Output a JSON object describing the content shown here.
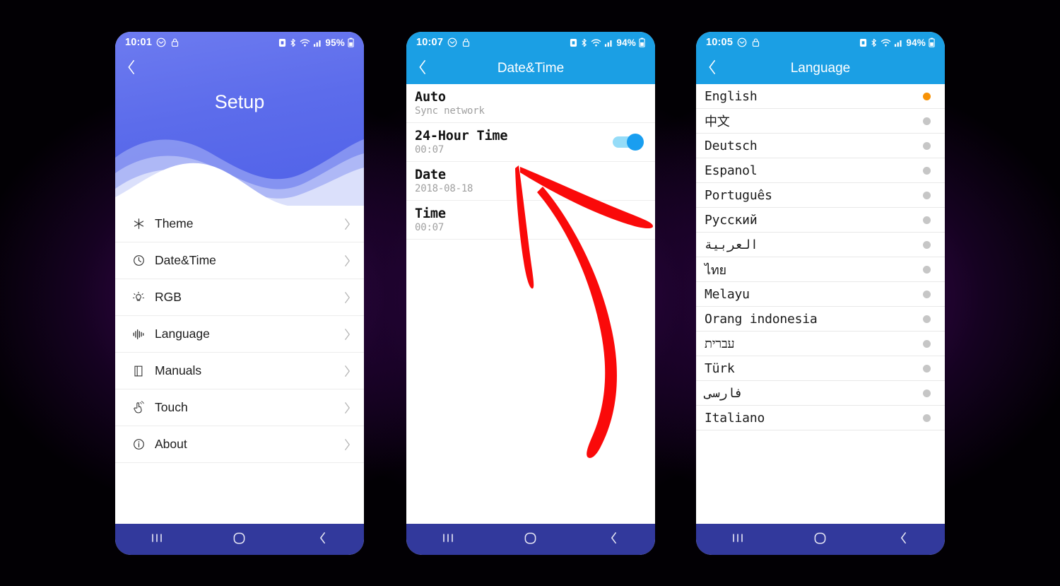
{
  "phones": [
    {
      "id": "setup",
      "statusbar": {
        "time": "10:01",
        "battery_pct": "95%",
        "icons_left": [
          "message-icon",
          "lock-icon"
        ],
        "icons_right": [
          "nfc-icon",
          "bluetooth-icon",
          "wifi-icon",
          "signal-icon",
          "battery-icon"
        ]
      },
      "appbar": {
        "title": "Setup",
        "back_icon": "chevron-left-icon"
      },
      "menu": [
        {
          "label": "Theme",
          "icon": "asterisk-icon",
          "chevron": "chevron-right-icon"
        },
        {
          "label": "Date&Time",
          "icon": "clock-icon",
          "chevron": "chevron-right-icon"
        },
        {
          "label": "RGB",
          "icon": "bulb-icon",
          "chevron": "chevron-right-icon"
        },
        {
          "label": "Language",
          "icon": "waveform-icon",
          "chevron": "chevron-right-icon"
        },
        {
          "label": "Manuals",
          "icon": "book-icon",
          "chevron": "chevron-right-icon"
        },
        {
          "label": "Touch",
          "icon": "touch-hand-icon",
          "chevron": "chevron-right-icon"
        },
        {
          "label": "About",
          "icon": "info-icon",
          "chevron": "chevron-right-icon"
        }
      ],
      "navbar": {
        "recents": "recents-icon",
        "home": "home-icon",
        "back": "back-icon"
      }
    },
    {
      "id": "datetime",
      "statusbar": {
        "time": "10:07",
        "battery_pct": "94%",
        "icons_left": [
          "message-icon",
          "lock-icon"
        ],
        "icons_right": [
          "nfc-icon",
          "bluetooth-icon",
          "wifi-icon",
          "signal-icon",
          "battery-icon"
        ]
      },
      "appbar": {
        "title": "Date&Time",
        "back_icon": "chevron-left-icon"
      },
      "rows": [
        {
          "title": "Auto",
          "sub": "Sync network",
          "toggle": null
        },
        {
          "title": "24-Hour Time",
          "sub": "00:07",
          "toggle": "on"
        },
        {
          "title": "Date",
          "sub": "2018-08-18",
          "toggle": null
        },
        {
          "title": "Time",
          "sub": "00:07",
          "toggle": null
        }
      ],
      "navbar": {
        "recents": "recents-icon",
        "home": "home-icon",
        "back": "back-icon"
      }
    },
    {
      "id": "language",
      "statusbar": {
        "time": "10:05",
        "battery_pct": "94%",
        "icons_left": [
          "message-icon",
          "lock-icon"
        ],
        "icons_right": [
          "nfc-icon",
          "bluetooth-icon",
          "wifi-icon",
          "signal-icon",
          "battery-icon"
        ]
      },
      "appbar": {
        "title": "Language",
        "back_icon": "chevron-left-icon"
      },
      "languages": [
        {
          "label": "English",
          "selected": true
        },
        {
          "label": "中文",
          "selected": false
        },
        {
          "label": "Deutsch",
          "selected": false
        },
        {
          "label": "Espanol",
          "selected": false
        },
        {
          "label": "Português",
          "selected": false
        },
        {
          "label": "Русский",
          "selected": false
        },
        {
          "label": "العربية",
          "selected": false
        },
        {
          "label": "ไทย",
          "selected": false
        },
        {
          "label": "Melayu",
          "selected": false
        },
        {
          "label": "Orang indonesia",
          "selected": false
        },
        {
          "label": "עברית",
          "selected": false
        },
        {
          "label": "Türk",
          "selected": false
        },
        {
          "label": "فارسی",
          "selected": false
        },
        {
          "label": "Italiano",
          "selected": false
        }
      ],
      "navbar": {
        "recents": "recents-icon",
        "home": "home-icon",
        "back": "back-icon"
      }
    }
  ],
  "annotation": {
    "shape": "hand-drawn-arrow",
    "color": "#fa0a0a",
    "points_to": "24-hour-time-row"
  },
  "colors": {
    "setup_header": "#5c6ceb",
    "blue_header": "#1b9fe4",
    "navbar": "#32399c",
    "toggle_on_track": "#95dcf8",
    "toggle_on_knob": "#199ef0",
    "selected_dot": "#f79206",
    "unselected_dot": "#c6c6c6",
    "annotation_red": "#fa0a0a"
  }
}
